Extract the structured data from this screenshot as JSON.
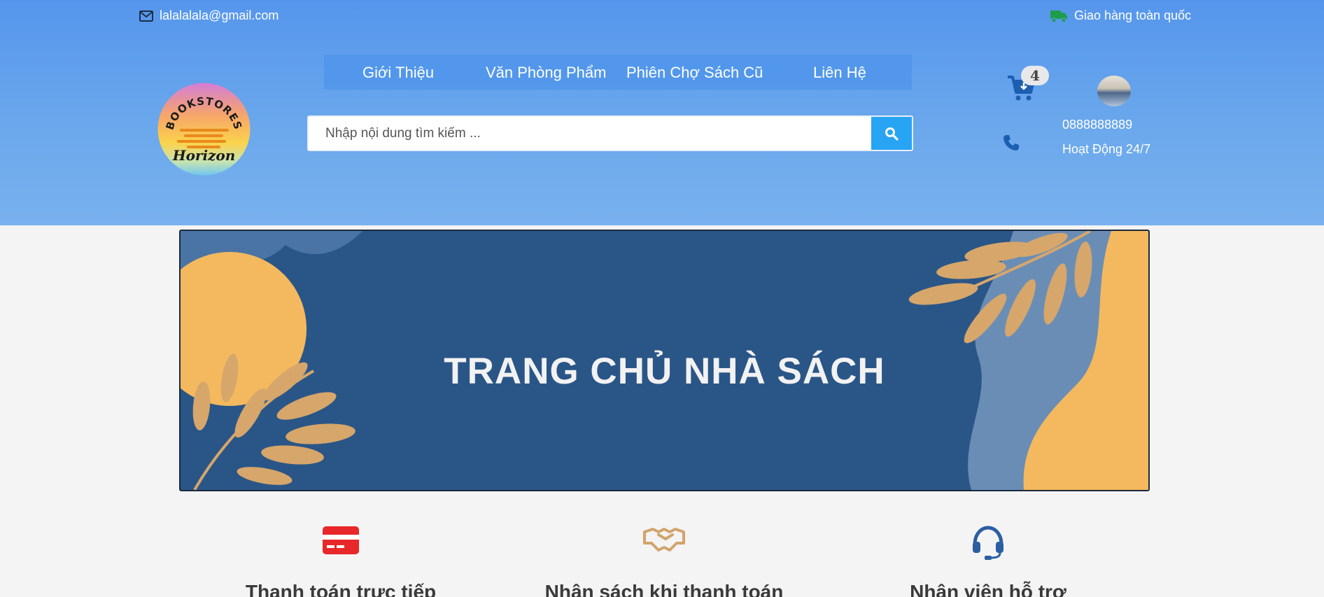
{
  "topbar": {
    "email": "lalalalala@gmail.com",
    "shipping": "Giao hàng toàn quốc",
    "email_icon": "envelope-icon",
    "shipping_icon": "truck-icon"
  },
  "logo": {
    "top_text": "BOOKSTORES",
    "bottom_text": "Horizon"
  },
  "nav": {
    "items": [
      "Giới Thiệu",
      "Văn Phòng Phẩm",
      "Phiên Chợ Sách Cũ",
      "Liên Hệ"
    ]
  },
  "search": {
    "placeholder": "Nhập nội dung tìm kiếm ...",
    "button_icon": "search-icon"
  },
  "cart": {
    "count": "4",
    "icon": "cart-icon"
  },
  "contact": {
    "phone": "0888888889",
    "hours": "Hoạt Động 24/7",
    "icon": "phone-icon"
  },
  "banner": {
    "title": "TRANG CHỦ NHÀ SÁCH"
  },
  "features": [
    {
      "title": "Thanh toán trực tiếp",
      "icon": "credit-card-icon",
      "color": "#e8272a"
    },
    {
      "title": "Nhận sách khi thanh toán",
      "icon": "handshake-icon",
      "color": "#d2a46b"
    },
    {
      "title": "Nhân viên hỗ trợ",
      "icon": "headset-icon",
      "color": "#2a5fa3"
    }
  ],
  "colors": {
    "header_gradient_top": "#5596ec",
    "header_gradient_bottom": "#79b1ee",
    "search_button": "#28a4f4",
    "banner_background": "#2a5687",
    "banner_accent": "#f4b95e",
    "banner_leaf": "#d6a66b",
    "shipping_icon": "#1e9e4a",
    "cart_icon": "#1c5fb0"
  }
}
